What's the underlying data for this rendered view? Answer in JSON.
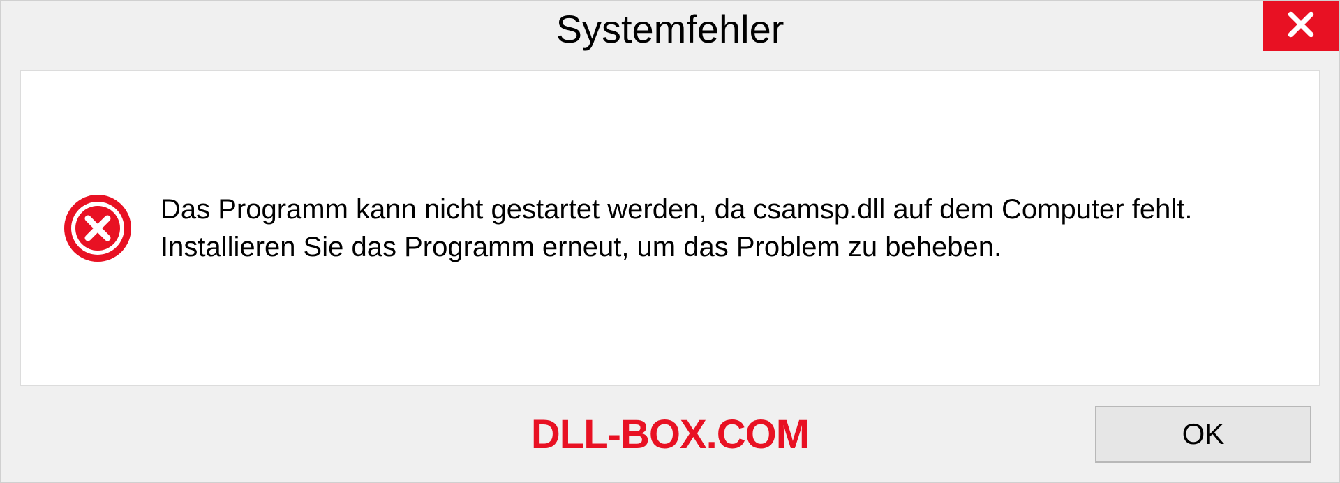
{
  "dialog": {
    "title": "Systemfehler",
    "message": "Das Programm kann nicht gestartet werden, da csamsp.dll auf dem Computer fehlt. Installieren Sie das Programm erneut, um das Problem zu beheben.",
    "ok_label": "OK"
  },
  "watermark": "DLL-BOX.COM"
}
